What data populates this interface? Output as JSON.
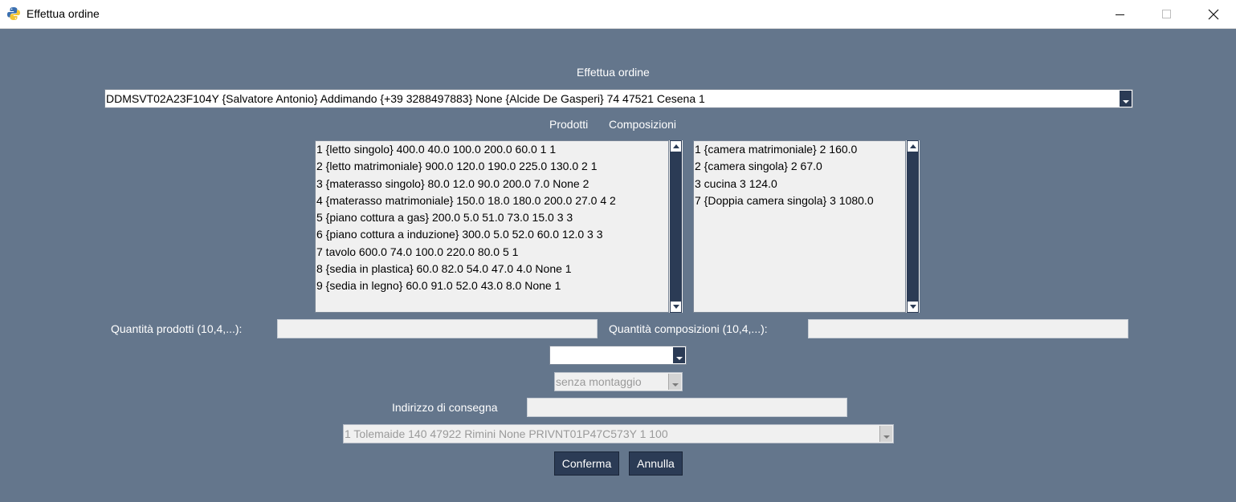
{
  "window": {
    "title": "Effettua ordine",
    "minimize_glyph": "—",
    "maximize_glyph": "☐",
    "close_glyph": "✕",
    "icon": "python-icon"
  },
  "header": {
    "title": "Effettua ordine"
  },
  "client_select": {
    "value": "DDMSVT02A23F104Y {Salvatore Antonio} Addimando {+39 3288497883} None {Alcide De Gasperi} 74 47521 Cesena 1"
  },
  "labels": {
    "prodotti": "Prodotti",
    "composizioni": "Composizioni"
  },
  "prodotti": [
    "1 {letto singolo} 400.0 40.0 100.0 200.0 60.0 1 1",
    "2 {letto matrimoniale} 900.0 120.0 190.0 225.0 130.0 2 1",
    "3 {materasso singolo} 80.0 12.0 90.0 200.0 7.0 None 2",
    "4 {materasso matrimoniale} 150.0 18.0 180.0 200.0 27.0 4 2",
    "5 {piano cottura a gas} 200.0 5.0 51.0 73.0 15.0 3 3",
    "6 {piano cottura a induzione} 300.0 5.0 52.0 60.0 12.0 3 3",
    "7 tavolo 600.0 74.0 100.0 220.0 80.0 5 1",
    "8 {sedia in plastica} 60.0 82.0 54.0 47.0 4.0 None 1",
    "9 {sedia in legno} 60.0 91.0 52.0 43.0 8.0 None 1"
  ],
  "composizioni": [
    "1 {camera matrimoniale} 2 160.0",
    "2 {camera singola} 2 67.0",
    "3 cucina 3 124.0",
    "7 {Doppia camera singola} 3 1080.0"
  ],
  "quantita": {
    "prodotti_label": "Quantità prodotti (10,4,...):",
    "prodotti_value": "",
    "composizioni_label": "Quantità composizioni (10,4,...):",
    "composizioni_value": ""
  },
  "type_select": {
    "value": ""
  },
  "montaggio_select": {
    "value": "senza montaggio"
  },
  "indirizzo": {
    "label": "Indirizzo di consegna",
    "value": ""
  },
  "address_select": {
    "value": "1 Tolemaide 140 47922 Rimini None PRIVNT01P47C573Y 1 100"
  },
  "buttons": {
    "confirm": "Conferma",
    "cancel": "Annulla"
  },
  "colors": {
    "background": "#64768c",
    "accent": "#2b3b55",
    "field": "#f0f0f0"
  }
}
